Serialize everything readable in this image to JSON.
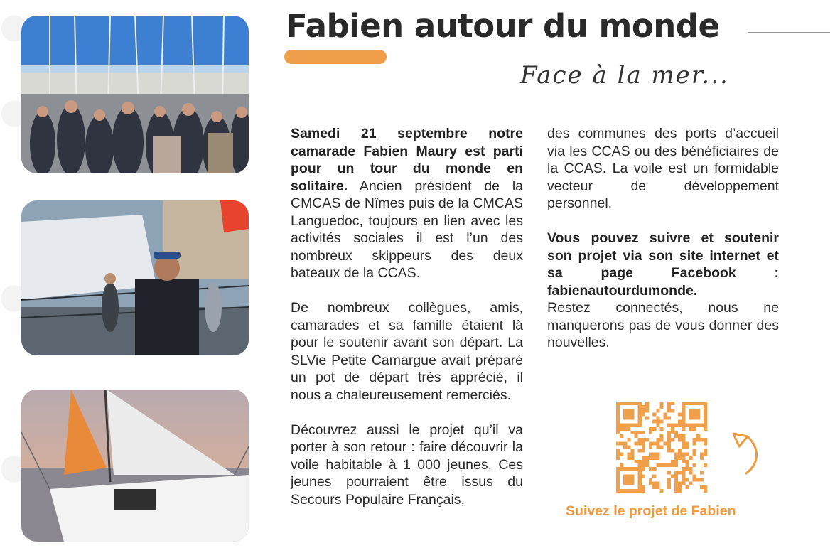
{
  "header": {
    "title": "Fabien autour du monde",
    "subtitle": "Face à la mer..."
  },
  "photos": [
    {
      "icon": "harbor-crowd-photo"
    },
    {
      "icon": "skipper-on-boat-photo"
    },
    {
      "icon": "sailboat-sunset-photo"
    }
  ],
  "column1": {
    "p1_bold": "Samedi 21 septembre notre camarade Fabien Maury est parti pour un tour du monde en solitaire.",
    "p1_text": " Ancien président de la CMCAS de Nîmes puis de la CMCAS Languedoc, toujours en lien avec les activités sociales il est l’un des nombreux skippeurs des deux bateaux de la CCAS.",
    "p2": "De nombreux collègues, amis, camarades et sa famille étaient là pour le soutenir avant son départ. La SLVie Petite Camargue avait préparé un pot de départ très apprécié, il nous a chaleureusement remerciés.",
    "p3": "Découvrez aussi le projet qu’il va porter à son retour : faire découvrir la voile habitable à 1 000 jeunes. Ces jeunes pourraient être issus du Secours Populaire Français,"
  },
  "column2": {
    "p1": "des communes des ports d’accueil via les CCAS ou des bénéficiaires de la CCAS. La voile est un formidable vecteur de développement personnel.",
    "p2_bold": "Vous pouvez suivre et soutenir son projet via son site internet et sa page Facebook : fabienautourdumonde.",
    "p2_text": "Restez connectés, nous ne manquerons pas de vous donner des nouvelles."
  },
  "qr": {
    "icon": "qr-code-icon",
    "caption": "Suivez le projet de Fabien"
  },
  "colors": {
    "accent": "#f0a04b",
    "text": "#2b2b2b"
  }
}
